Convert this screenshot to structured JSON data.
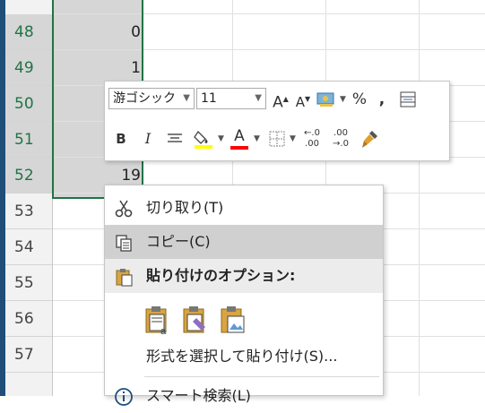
{
  "rows": [
    {
      "num": "48",
      "value": "0",
      "selected": true
    },
    {
      "num": "49",
      "value": "1",
      "selected": true
    },
    {
      "num": "50",
      "value": "",
      "selected": true
    },
    {
      "num": "51",
      "value": "",
      "selected": true
    },
    {
      "num": "52",
      "value": "19",
      "selected": true
    },
    {
      "num": "53",
      "value": "",
      "selected": false
    },
    {
      "num": "54",
      "value": "",
      "selected": false
    },
    {
      "num": "55",
      "value": "",
      "selected": false
    },
    {
      "num": "56",
      "value": "",
      "selected": false
    },
    {
      "num": "57",
      "value": "",
      "selected": false
    }
  ],
  "mini_toolbar": {
    "font_name": "游ゴシック",
    "font_size": "11",
    "grow_label": "A",
    "shrink_label": "A",
    "percent_label": "%",
    "comma_label": ",",
    "bold_label": "B",
    "italic_label": "I",
    "font_color_label": "A",
    "decimal_increase_label": ".00",
    "decimal_decrease_label": ".00",
    "highlight_color": "#ffff00",
    "font_color": "#ff0000"
  },
  "context_menu": {
    "cut": "切り取り(T)",
    "copy": "コピー(C)",
    "paste_options": "貼り付けのオプション:",
    "paste_special": "形式を選択して貼り付け(S)...",
    "smart_lookup": "スマート検索(L)"
  },
  "colors": {
    "selection_border": "#217346",
    "window_border": "#1f4e79"
  }
}
